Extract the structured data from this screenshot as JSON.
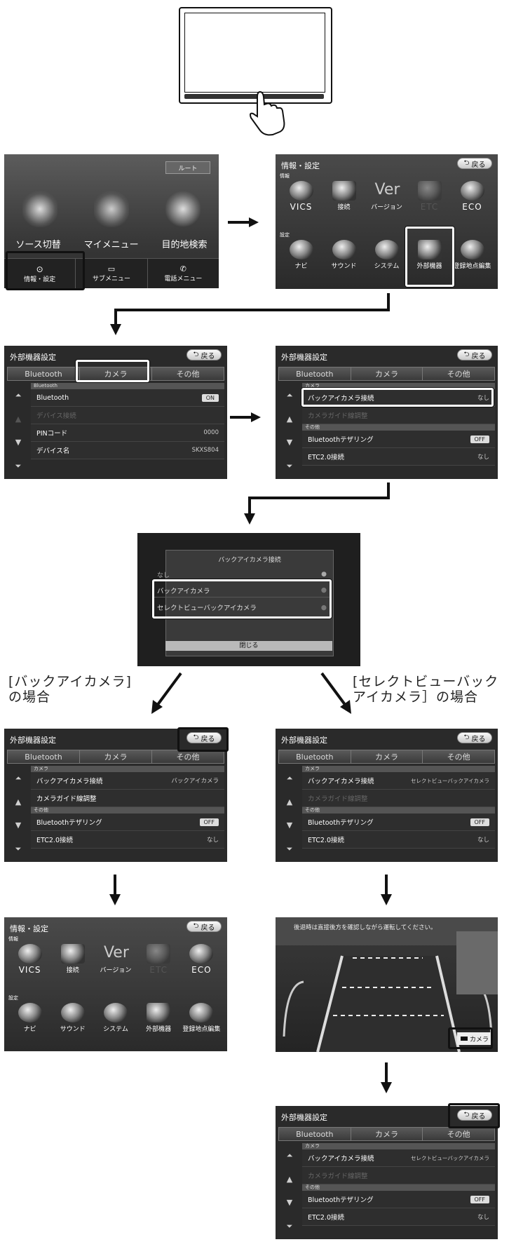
{
  "info_settings": {
    "title": "情報・設定",
    "back": "戻る",
    "section_info": "情報",
    "section_settings": "設定",
    "info_items": [
      "VICS",
      "接続",
      "バージョン",
      "ETC",
      "ECO"
    ],
    "settings_items": [
      "ナビ",
      "サウンド",
      "システム",
      "外部機器",
      "登録地点編集"
    ]
  },
  "home": {
    "top_button": "ルート",
    "items": [
      "ソース切替",
      "マイメニュー",
      "目的地検索"
    ],
    "bottom": [
      "情報・設定",
      "サブメニュー",
      "電話メニュー"
    ]
  },
  "external_settings": {
    "title": "外部機器設定",
    "back": "戻る",
    "tabs": [
      "Bluetooth",
      "カメラ",
      "その他"
    ],
    "section_bluetooth": "Bluetooth",
    "section_camera": "カメラ",
    "section_other": "その他",
    "bt_rows": [
      {
        "label": "Bluetooth",
        "value": "ON"
      },
      {
        "label": "デバイス接続",
        "value": ""
      },
      {
        "label": "PINコード",
        "value": "0000"
      },
      {
        "label": "デバイス名",
        "value": "SKXS804"
      }
    ],
    "back_camera": "バックアイカメラ接続",
    "camera_guide": "カメラガイド線調整",
    "bt_tethering": "Bluetoothテザリング",
    "etc": "ETC2.0接続",
    "none": "なし",
    "off": "OFF",
    "value_backeye": "バックアイカメラ",
    "value_selectview": "セレクトビューバックアイカメラ"
  },
  "popup": {
    "title": "バックアイカメラ接続",
    "options": [
      "なし",
      "バックアイカメラ",
      "セレクトビューバックアイカメラ"
    ],
    "close": "閉じる"
  },
  "captions": {
    "left": [
      "[バックアイカメラ]",
      "の場合"
    ],
    "right": [
      "[セレクトビューバック",
      "アイカメラ］の場合"
    ]
  },
  "camera_view": {
    "warning": "後退時は直接後方を確認しながら運転してください。",
    "camera_button": "カメラ"
  }
}
